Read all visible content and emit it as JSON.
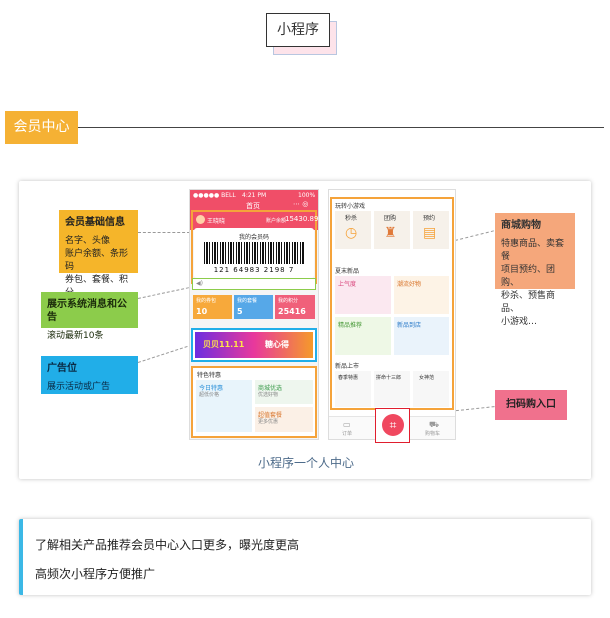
{
  "title_tag": "小程序",
  "section_title": "会员中心",
  "caption": "小程序一个人中心",
  "callouts": {
    "member_info": {
      "title": "会员基础信息",
      "lines": [
        "名字、头像",
        "账户余额、条形码",
        "券包、套餐、积分"
      ]
    },
    "notice": {
      "title": "展示系统消息和公告",
      "desc": "滚动最新10条"
    },
    "ads": {
      "title": "广告位",
      "desc": "展示活动或广告"
    },
    "mall": {
      "title": "商城购物",
      "lines": [
        "特惠商品、卖套餐",
        "项目预约、团购、",
        "秒杀、预售商品、",
        "小游戏…"
      ]
    },
    "scan": {
      "title": "扫码购入口"
    }
  },
  "phone1": {
    "status_left": "●●●●● BELL",
    "status_time": "4:21 PM",
    "status_right": "100%",
    "app_title": "首页",
    "user_name": "王晓晓",
    "balance_label": "账户余额",
    "balance_value": "15430.89",
    "card_title": "我的会员码",
    "barcode_number": "121 64983 2198 7",
    "stats": [
      {
        "label": "我的券包",
        "value": "10",
        "color": "#f7a93b"
      },
      {
        "label": "我的套餐",
        "value": "5",
        "color": "#56a8e8"
      },
      {
        "label": "我的积分",
        "value": "25416",
        "color": "#f0607a"
      }
    ],
    "ad_text_1": "贝贝11.11",
    "ad_text_2": "糖心得",
    "special_title": "特色特惠",
    "specials": [
      {
        "title": "今日特惠",
        "desc": "超低价格"
      },
      {
        "title": "商城优选",
        "desc": "优选好物"
      },
      {
        "title": "超值套餐",
        "desc": "更多优惠"
      }
    ]
  },
  "phone2": {
    "games_title": "玩转小游戏",
    "games": [
      "秒杀",
      "团购",
      "预约"
    ],
    "new_title": "夏末新品",
    "new_items": [
      "上气度",
      "潮流好物",
      "精品推荐",
      "新品到店"
    ],
    "arrival_title": "新品上市",
    "arrivals": [
      "春季特惠",
      "拼命十三郎",
      "女神范"
    ],
    "nav_left": "订单",
    "nav_right": "购物车"
  },
  "note_lines": [
    "了解相关产品推荐会员中心入口更多，曝光度更高",
    "高频次小程序方便推广"
  ]
}
